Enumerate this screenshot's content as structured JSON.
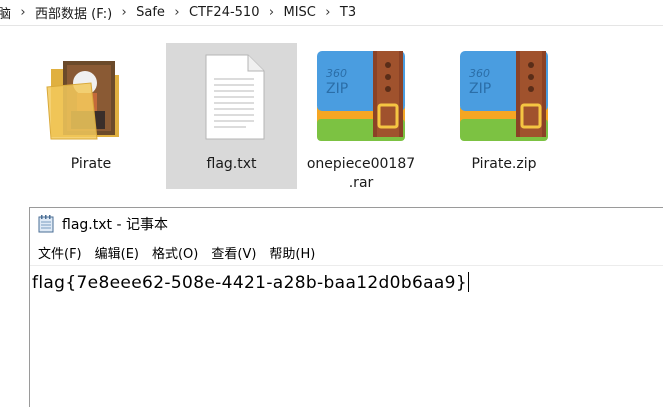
{
  "breadcrumb": {
    "items": [
      "脑",
      "西部数据 (F:)",
      "Safe",
      "CTF24-510",
      "MISC",
      "T3"
    ],
    "separator": "›"
  },
  "files": [
    {
      "name_lines": [
        "Pirate"
      ],
      "icon": "folder-icon",
      "selected": false
    },
    {
      "name_lines": [
        "flag.txt"
      ],
      "icon": "text-file-icon",
      "selected": true
    },
    {
      "name_lines": [
        "onepiece00187",
        ".rar"
      ],
      "icon": "zip-archive-icon",
      "selected": false
    },
    {
      "name_lines": [
        "Pirate.zip"
      ],
      "icon": "zip-archive-icon",
      "selected": false
    }
  ],
  "archive_icon_label": [
    "360",
    "ZIP"
  ],
  "notepad": {
    "title": "flag.txt - 记事本",
    "menu": [
      "文件(F)",
      "编辑(E)",
      "格式(O)",
      "查看(V)",
      "帮助(H)"
    ],
    "content": "flag{7e8eee62-508e-4421-a28b-baa12d0b6aa9}"
  },
  "colors": {
    "selection": "#d9d9d9",
    "zip_blue": "#4a9de0",
    "zip_orange": "#f5a623",
    "zip_green": "#7cc242",
    "zip_strap": "#a0522d",
    "folder": "#f2c95c"
  }
}
